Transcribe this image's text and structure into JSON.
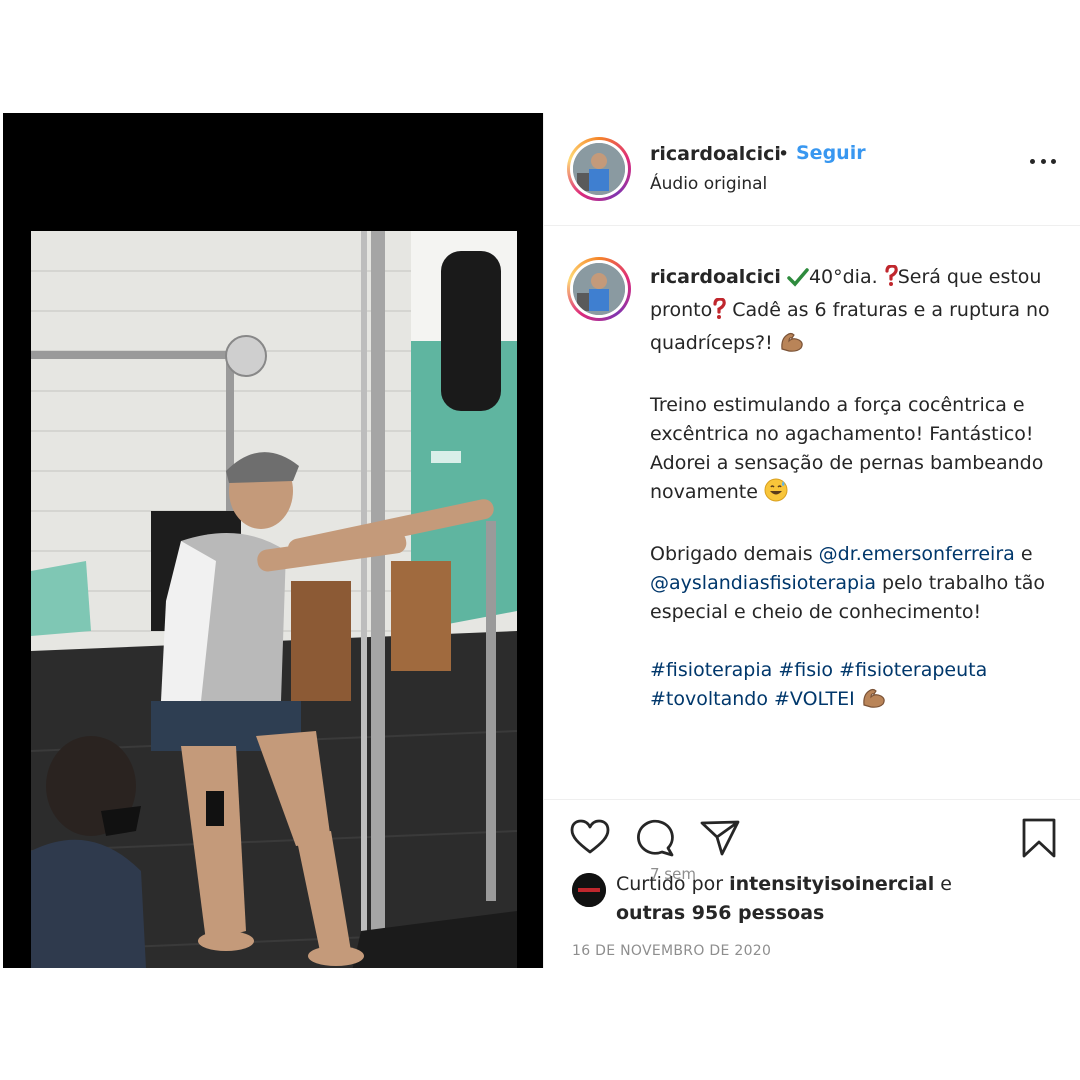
{
  "header": {
    "username": "ricardoalcici",
    "separator": "•",
    "follow_label": "Seguir",
    "audio_label": "Áudio original",
    "more_icon": "more-horizontal-icon"
  },
  "caption": {
    "username": "ricardoalcici",
    "line1_a": "40°dia.",
    "line1_b": "Será que estou pronto",
    "line1_c": "Cadê as 6 fraturas e a ruptura no quadríceps?!",
    "para2": "Treino estimulando a força cocêntrica e excêntrica no agachamento! Fantástico! Adorei a sensação de pernas bambeando novamente",
    "para3_a": "Obrigado demais",
    "mention1": "@dr.emersonferreira",
    "para3_b": "e",
    "mention2": "@ayslandiasfisioterapia",
    "para3_c": "pelo trabalho tão especial e cheio de conhecimento!",
    "hashtags": [
      "#fisioterapia",
      "#fisio",
      "#fisioterapeuta",
      "#tovoltando",
      "#VOLTEI"
    ],
    "time_ago": "7 sem"
  },
  "actions": {
    "icons": [
      "heart-icon",
      "comment-icon",
      "share-icon",
      "bookmark-icon"
    ]
  },
  "likes": {
    "prefix": "Curtido por",
    "liker": "intensityisoinercial",
    "conj": "e",
    "others": "outras 956 pessoas"
  },
  "date": "16 DE NOVEMBRO DE 2020",
  "colors": {
    "link": "#00376b",
    "follow": "#3897f0",
    "muted": "#8e8e8e",
    "text": "#262626"
  }
}
